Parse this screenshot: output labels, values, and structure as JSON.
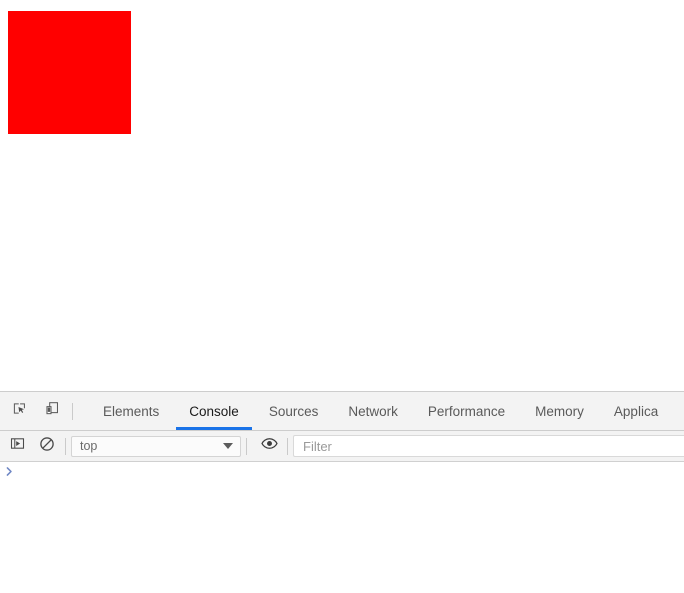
{
  "page": {
    "red_box": {
      "name": "red-square",
      "color": "#ff0000",
      "width": "123",
      "height": "123"
    }
  },
  "devtools": {
    "tabbar": {
      "left_buttons": [
        {
          "icon": "inspect-element-icon",
          "title": "Inspect element"
        },
        {
          "icon": "device-toolbar-icon",
          "title": "Toggle device toolbar"
        }
      ],
      "tabs": [
        {
          "label": "Elements",
          "active": false
        },
        {
          "label": "Console",
          "active": true
        },
        {
          "label": "Sources",
          "active": false
        },
        {
          "label": "Network",
          "active": false
        },
        {
          "label": "Performance",
          "active": false
        },
        {
          "label": "Memory",
          "active": false
        },
        {
          "label": "Applica",
          "active": false
        }
      ],
      "active_tab": "Console",
      "active_underline_color": "#1a73e8"
    },
    "console_toolbar": {
      "sidebar_toggle": {
        "icon": "console-sidebar-icon",
        "title": "Show console sidebar"
      },
      "clear_console": {
        "icon": "clear-console-icon",
        "title": "Clear console"
      },
      "context": {
        "value": "top",
        "caret": "chevron-down-icon"
      },
      "live_expression": {
        "icon": "eye-icon",
        "title": "Create live expression"
      },
      "filter": {
        "value": "",
        "placeholder": "Filter"
      }
    },
    "console_body": {
      "prompt_symbol": "›",
      "prompt_color": "#6e86c4",
      "input_value": "",
      "messages": []
    }
  }
}
